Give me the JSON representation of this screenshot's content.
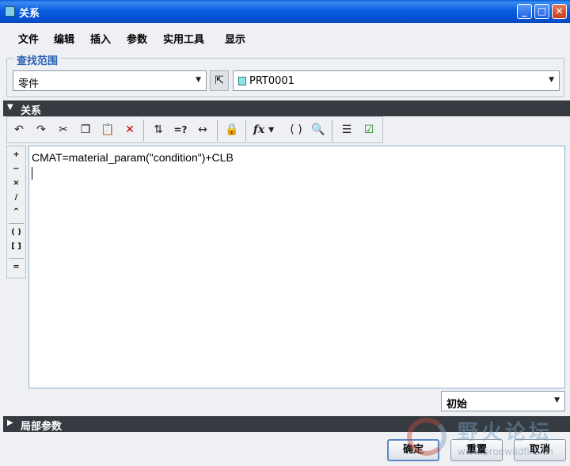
{
  "window": {
    "title": "关系"
  },
  "menu": [
    "文件",
    "编辑",
    "插入",
    "参数",
    "实用工具",
    "显示"
  ],
  "scope": {
    "group_label": "查找范围",
    "type_value": "零件",
    "model_value": "PRT0001"
  },
  "relations": {
    "section_label": "关系",
    "text": "CMAT=material_param(\"condition\")+CLB",
    "operators": [
      "+",
      "−",
      "×",
      "/",
      "^",
      "( )",
      "[ ]",
      "="
    ]
  },
  "toolbar_icons": [
    "undo-icon",
    "redo-icon",
    "cut-icon",
    "copy-icon",
    "paste-icon",
    "delete-icon",
    "sort-relations-icon",
    "evaluate-icon",
    "measure-icon",
    "locked-params-icon",
    "function-icon",
    "brackets-icon",
    "units-icon",
    "show-params-icon",
    "verify-icon"
  ],
  "state_select": {
    "value": "初始"
  },
  "local_params": {
    "section_label": "局部参数"
  },
  "buttons": {
    "ok": "确定",
    "reset": "重置",
    "cancel": "取消"
  },
  "watermark": {
    "cn": "野火论坛",
    "en": "www.proewildfire.cn"
  }
}
